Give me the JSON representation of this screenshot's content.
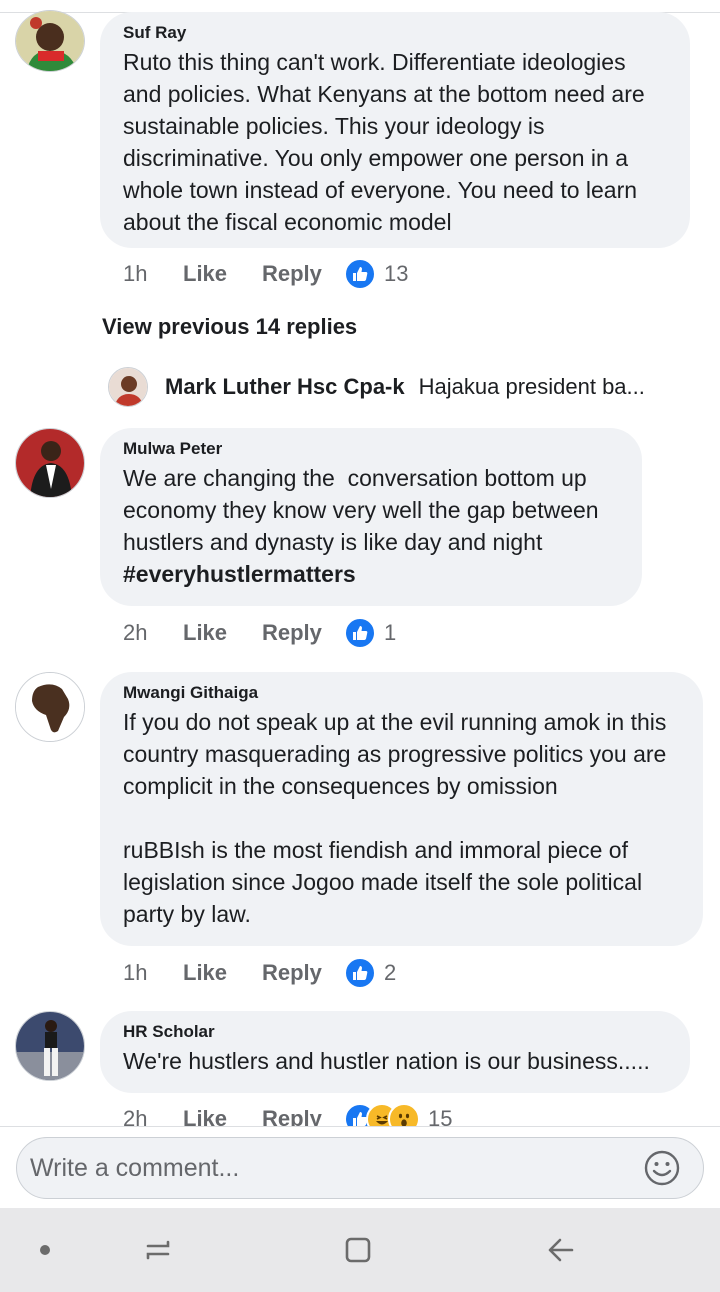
{
  "comments": [
    {
      "author": "Suf Ray",
      "text": "Ruto this thing can't work. Differentiate ideologies and policies. What Kenyans at the bottom need are sustainable policies. This your ideology is discriminative. You only empower one person in a whole town instead of everyone. You need to learn about the fiscal economic model",
      "time": "1h",
      "like_label": "Like",
      "reply_label": "Reply",
      "reaction_count": "13"
    },
    {
      "author": "Mulwa Peter",
      "text": "We are changing the  conversation bottom up economy they know very well the gap between hustlers and dynasty is like day and night",
      "hashtag": "#everyhustlermatters",
      "time": "2h",
      "like_label": "Like",
      "reply_label": "Reply",
      "reaction_count": "1"
    },
    {
      "author": "Mwangi Githaiga",
      "text": "If you do not speak up at the evil running amok in this country masquerading as progressive politics you are complicit in the consequences by omission\n\nruBBIsh is the most fiendish and immoral piece of legislation since Jogoo made itself the sole political party by law.",
      "time": "1h",
      "like_label": "Like",
      "reply_label": "Reply",
      "reaction_count": "2"
    },
    {
      "author": "HR Scholar",
      "text": "We're hustlers and hustler nation is our business.....",
      "time": "2h",
      "like_label": "Like",
      "reply_label": "Reply",
      "reaction_count": "15"
    }
  ],
  "view_previous": "View previous 14 replies",
  "collapsed_reply": {
    "name": "Mark Luther Hsc Cpa-k",
    "snippet": "Hajakua president ba..."
  },
  "composer": {
    "placeholder": "Write a comment..."
  },
  "colors": {
    "like_blue": "#1877f2",
    "bubble_bg": "#f0f2f5",
    "meta_gray": "#65676b"
  }
}
